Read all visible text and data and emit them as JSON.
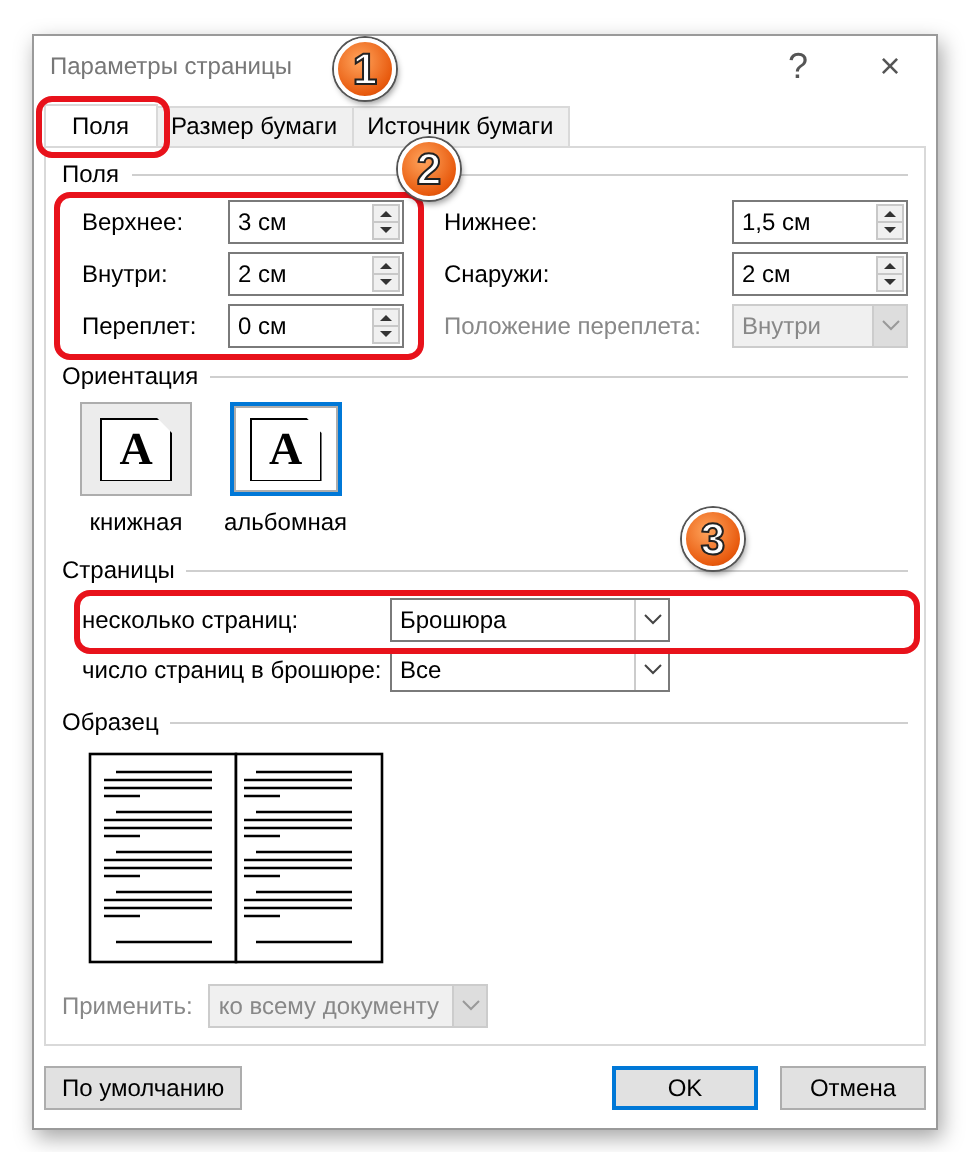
{
  "window": {
    "title": "Параметры страницы",
    "help": "?",
    "close": "×"
  },
  "tabs": [
    {
      "label": "Поля",
      "selected": true
    },
    {
      "label": "Размер бумаги",
      "selected": false
    },
    {
      "label": "Источник бумаги",
      "selected": false
    }
  ],
  "margins": {
    "heading": "Поля",
    "left": [
      {
        "label": "Верхнее:",
        "value": "3 см",
        "kind": "spin",
        "disabled": false
      },
      {
        "label": "Внутри:",
        "value": "2 см",
        "kind": "spin",
        "disabled": false
      },
      {
        "label": "Переплет:",
        "value": "0 см",
        "kind": "spin",
        "disabled": false
      }
    ],
    "right": [
      {
        "label": "Нижнее:",
        "value": "1,5 см",
        "kind": "spin",
        "disabled": false
      },
      {
        "label": "Снаружи:",
        "value": "2 см",
        "kind": "spin",
        "disabled": false
      },
      {
        "label": "Положение переплета:",
        "value": "Внутри",
        "kind": "select",
        "disabled": true
      }
    ]
  },
  "orientation": {
    "heading": "Ориентация",
    "options": [
      {
        "label": "книжная",
        "glyph": "A",
        "selected": false
      },
      {
        "label": "альбомная",
        "glyph": "A",
        "selected": true
      }
    ]
  },
  "pages": {
    "heading": "Страницы",
    "rows": [
      {
        "label": "несколько страниц:",
        "value": "Брошюра"
      },
      {
        "label": "число страниц в брошюре:",
        "value": "Все"
      }
    ]
  },
  "preview": {
    "heading": "Образец"
  },
  "apply": {
    "label": "Применить:",
    "value": "ко всему документу",
    "disabled": true
  },
  "buttons": [
    {
      "label": "По умолчанию",
      "kind": "plain"
    },
    {
      "label": "OK",
      "kind": "default"
    },
    {
      "label": "Отмена",
      "kind": "plain"
    }
  ],
  "annotations": [
    {
      "number": "1"
    },
    {
      "number": "2"
    },
    {
      "number": "3"
    }
  ]
}
